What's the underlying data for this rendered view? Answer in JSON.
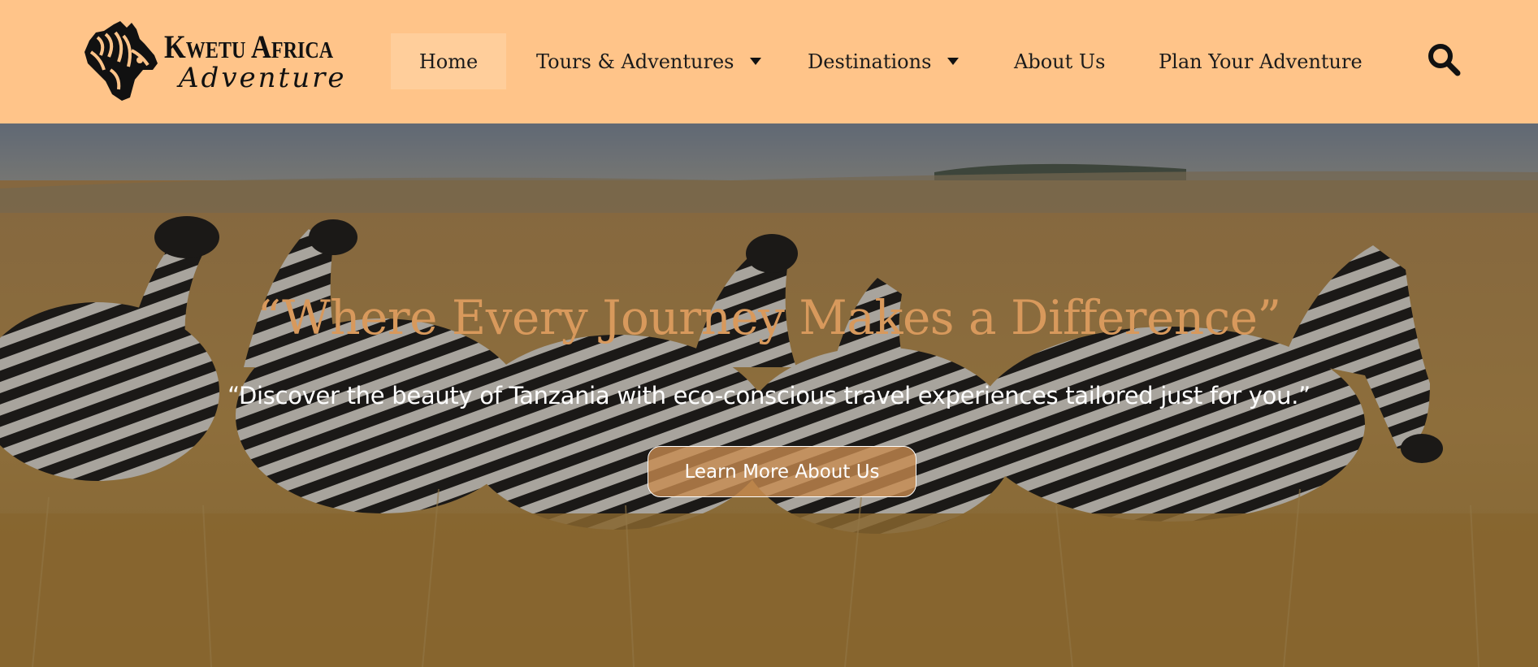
{
  "brand": {
    "name": "Kwetu Africa",
    "tagline": "Adventure"
  },
  "nav": {
    "items": [
      {
        "label": "Home",
        "active": true,
        "has_dropdown": false
      },
      {
        "label": "Tours & Adventures",
        "active": false,
        "has_dropdown": true
      },
      {
        "label": "Destinations",
        "active": false,
        "has_dropdown": true
      },
      {
        "label": "About Us",
        "active": false,
        "has_dropdown": false
      },
      {
        "label": "Plan Your Adventure",
        "active": false,
        "has_dropdown": false
      }
    ],
    "search_icon": "search-icon"
  },
  "hero": {
    "title": "“Where Every Journey Makes a Difference”",
    "subtitle": "“Discover the beauty of Tanzania with eco-conscious travel experiences tailored just for you.”",
    "cta_label": "Learn More About Us",
    "background": "zebra herd in savanna grassland"
  },
  "colors": {
    "header_bg": "#ffc489",
    "nav_active_bg": "#fac790",
    "title": "#d8995c",
    "cta_bg": "#c98c50",
    "text_dark": "#1b1b1b"
  }
}
